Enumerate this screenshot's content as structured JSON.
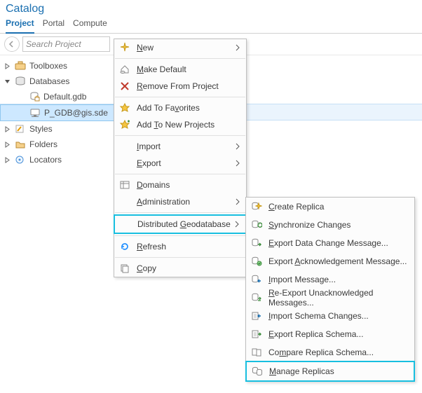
{
  "title": "Catalog",
  "tabs": [
    "Project",
    "Portal",
    "Compute"
  ],
  "activeTab": 0,
  "search": {
    "placeholder": "Search Project"
  },
  "tree": {
    "items": [
      {
        "label": "Toolboxes"
      },
      {
        "label": "Databases"
      },
      {
        "label": "Styles"
      },
      {
        "label": "Folders"
      },
      {
        "label": "Locators"
      }
    ],
    "databases": {
      "children": [
        {
          "label": "Default.gdb"
        },
        {
          "label": "P_GDB@gis.sde",
          "selected": true
        }
      ]
    }
  },
  "menu": [
    {
      "label": "New",
      "icon": "sparkle",
      "submenu": true,
      "u": 0
    },
    {
      "sep": true
    },
    {
      "label": "Make Default",
      "icon": "home",
      "u": 0
    },
    {
      "label": "Remove From Project",
      "icon": "remove",
      "u": 0
    },
    {
      "sep": true
    },
    {
      "label": "Add To Favorites",
      "icon": "star",
      "u": 9
    },
    {
      "label": "Add To New Projects",
      "icon": "star-plus",
      "u": 4
    },
    {
      "sep": true
    },
    {
      "label": "Import",
      "icon": "none",
      "submenu": true,
      "u": 0
    },
    {
      "label": "Export",
      "icon": "none",
      "submenu": true,
      "u": 0
    },
    {
      "sep": true
    },
    {
      "label": "Domains",
      "icon": "domains",
      "u": 0
    },
    {
      "label": "Administration",
      "icon": "none",
      "submenu": true,
      "u": 0
    },
    {
      "sep": true
    },
    {
      "label": "Distributed Geodatabase",
      "icon": "none",
      "submenu": true,
      "highlight": true,
      "u": 12
    },
    {
      "sep": true
    },
    {
      "label": "Refresh",
      "icon": "refresh",
      "u": 0
    },
    {
      "sep": true
    },
    {
      "label": "Copy",
      "icon": "copy",
      "u": 0
    }
  ],
  "submenu": [
    {
      "label": "Create Replica",
      "icon": "db-new",
      "u": 0
    },
    {
      "label": "Synchronize Changes",
      "icon": "db-sync",
      "u": 0
    },
    {
      "sep": true
    },
    {
      "label": "Export Data Change Message...",
      "icon": "db-out",
      "u": 0
    },
    {
      "label": "Export Acknowledgement Message...",
      "icon": "db-ack",
      "u": 7
    },
    {
      "label": "Import Message...",
      "icon": "db-in",
      "u": 0
    },
    {
      "sep": true
    },
    {
      "label": "Re-Export Unacknowledged Messages...",
      "icon": "db-re",
      "u": 0
    },
    {
      "sep": true
    },
    {
      "label": "Import Schema Changes...",
      "icon": "schema-in",
      "u": 0
    },
    {
      "label": "Export Replica Schema...",
      "icon": "schema-out",
      "u": 0
    },
    {
      "label": "Compare Replica Schema...",
      "icon": "schema-cmp",
      "u": 2
    },
    {
      "sep": true
    },
    {
      "label": "Manage Replicas",
      "icon": "manage",
      "highlight": true,
      "u": 0
    }
  ]
}
